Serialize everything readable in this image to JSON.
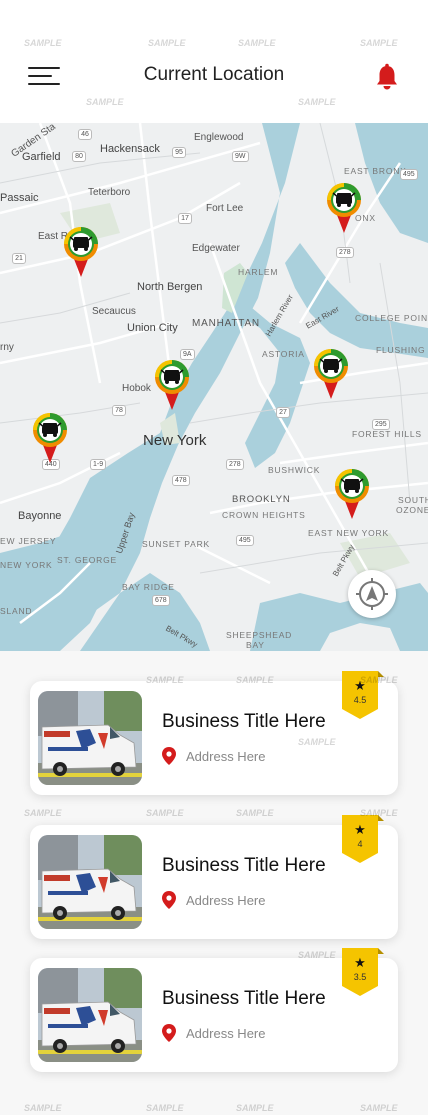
{
  "header": {
    "title": "Current Location",
    "menu_icon": "hamburger-menu-icon",
    "notification_icon": "bell-icon",
    "accent_color": "#d41c1c"
  },
  "map": {
    "labels": {
      "garden_state": "Garden Sta",
      "garfield": "Garfield",
      "hackensack": "Hackensack",
      "englewood": "Englewood",
      "passaic": "Passaic",
      "teterboro": "Teterboro",
      "fort_lee": "Fort Lee",
      "east_rutherford": "East Ruthe",
      "edgewater": "Edgewater",
      "north_bergen": "North Bergen",
      "secaucus": "Secaucus",
      "union_city": "Union City",
      "manhattan": "MANHATTAN",
      "harlem": "HARLEM",
      "east_bronx": "EAST BRONX",
      "bronx": "ONX",
      "college_point": "COLLEGE POINT",
      "astoria": "ASTORIA",
      "flushing": "FLUSHING",
      "hoboken": "Hobok",
      "kearny": "rny",
      "new_york": "New York",
      "forest_hills": "FOREST HILLS",
      "bushwick": "BUSHWICK",
      "brooklyn": "BROOKLYN",
      "crown_heights": "CROWN HEIGHTS",
      "bayonne": "Bayonne",
      "new_jersey": "EW JERSEY",
      "new_york_state": "NEW YORK",
      "st_george": "ST. GEORGE",
      "upper_bay": "Upper Bay",
      "sunset_park": "SUNSET PARK",
      "east_new_york": "EAST NEW YORK",
      "bay_ridge": "BAY RIDGE",
      "island": "SLAND",
      "sheepshead_bay": "SHEEPSHEAD",
      "bay": "BAY",
      "south_ozone": "SOUTH",
      "ozone": "OZONE",
      "east_river": "East River",
      "belt_pkwy": "Belt Pkwy",
      "harlem_river": "Harlem River"
    },
    "route_shields": [
      "46",
      "80",
      "95",
      "9W",
      "17",
      "495",
      "278",
      "21",
      "9A",
      "78",
      "440",
      "1-9",
      "278",
      "27",
      "478",
      "295",
      "678",
      "495"
    ],
    "marker_icon": "auto-repair-map-pin-icon",
    "locate_icon": "locate-me-compass-icon"
  },
  "businesses": [
    {
      "title": "Business Title Here",
      "address": "Address Here",
      "rating": "4.5",
      "image_icon": "repair-van-photo"
    },
    {
      "title": "Business Title Here",
      "address": "Address Here",
      "rating": "4",
      "image_icon": "repair-van-photo"
    },
    {
      "title": "Business Title Here",
      "address": "Address Here",
      "rating": "3.5",
      "image_icon": "repair-van-photo"
    }
  ],
  "watermark": "SAMPLE",
  "colors": {
    "pin_red": "#d41c1c",
    "badge_yellow": "#f5c400",
    "pin_ring_green": "#2e9b2e",
    "pin_ring_orange": "#f08c00"
  }
}
